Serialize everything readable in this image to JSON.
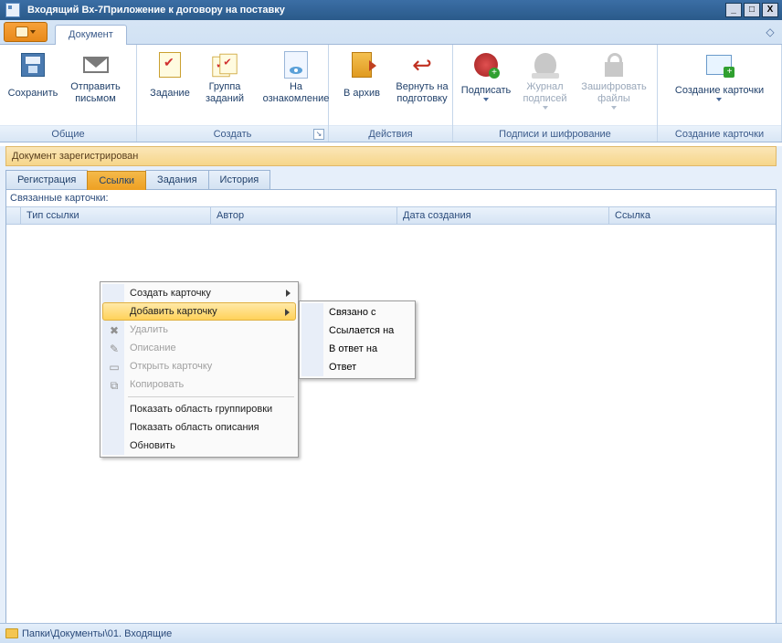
{
  "window": {
    "title": "Входящий Вх-7Приложение к договору на поставку"
  },
  "ribbon": {
    "tab": "Документ",
    "groups": {
      "general": {
        "label": "Общие",
        "save": "Сохранить",
        "send": "Отправить письмом"
      },
      "create": {
        "label": "Создать",
        "task": "Задание",
        "taskgroup": "Группа заданий",
        "review": "На ознакомление"
      },
      "actions": {
        "label": "Действия",
        "archive": "В архив",
        "return": "Вернуть на подготовку"
      },
      "sign": {
        "label": "Подписи и шифрование",
        "sign": "Подписать",
        "journal": "Журнал подписей",
        "encrypt": "Зашифровать файлы"
      },
      "card": {
        "label": "Создание карточки",
        "create": "Создание карточки"
      }
    }
  },
  "status_strip": "Документ зарегистрирован",
  "tabs": {
    "reg": "Регистрация",
    "links": "Ссылки",
    "tasks": "Задания",
    "history": "История"
  },
  "links_panel": {
    "title": "Связанные карточки:",
    "cols": {
      "type": "Тип ссылки",
      "author": "Автор",
      "date": "Дата создания",
      "link": "Ссылка"
    }
  },
  "ctx": {
    "create_card": "Создать карточку",
    "add_card": "Добавить карточку",
    "delete": "Удалить",
    "descr": "Описание",
    "open": "Открыть карточку",
    "copy": "Копировать",
    "show_group": "Показать область группировки",
    "show_descr": "Показать область описания",
    "refresh": "Обновить",
    "sub": {
      "related": "Связано с",
      "refs": "Ссылается на",
      "reply_to": "В ответ на",
      "answer": "Ответ"
    }
  },
  "statusbar": {
    "path": "Папки\\Документы\\01. Входящие"
  }
}
